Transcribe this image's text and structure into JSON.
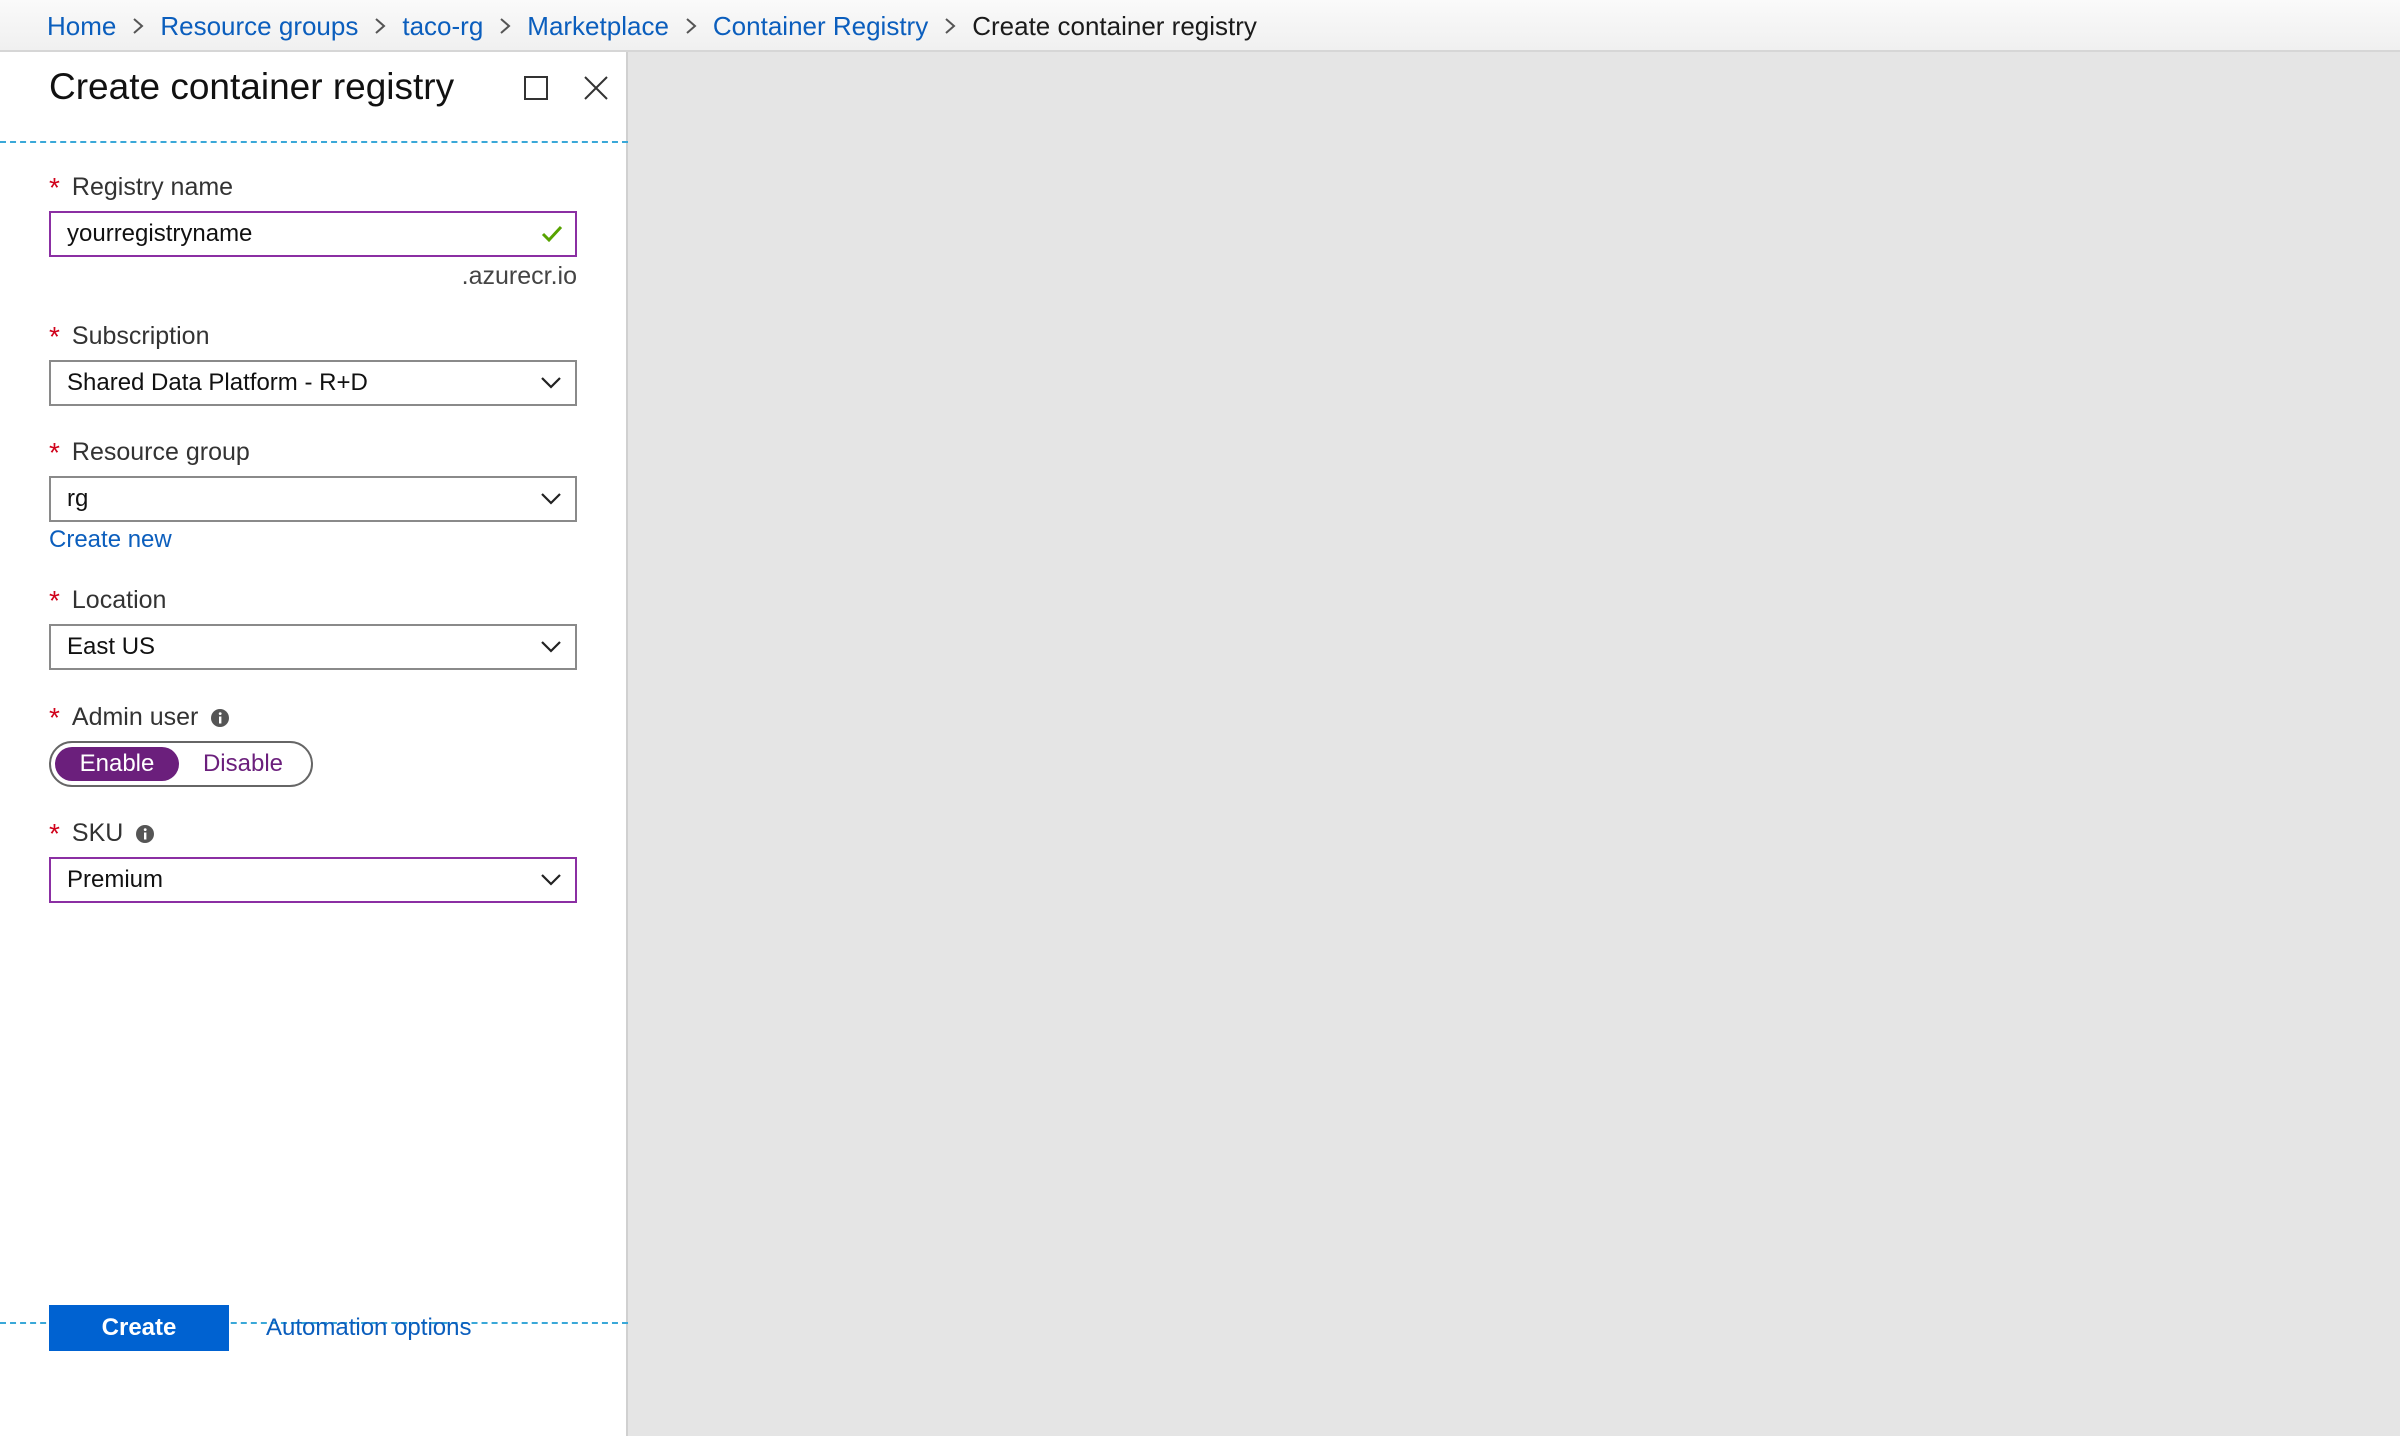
{
  "breadcrumb": {
    "items": [
      "Home",
      "Resource groups",
      "taco-rg",
      "Marketplace",
      "Container Registry"
    ],
    "current": "Create container registry"
  },
  "blade": {
    "title": "Create container registry",
    "maximize_icon": "maximize-icon",
    "close_icon": "close-icon"
  },
  "form": {
    "registry_name": {
      "label": "Registry name",
      "value": "yourregistryname",
      "suffix": ".azurecr.io",
      "valid_icon": "checkmark-icon"
    },
    "subscription": {
      "label": "Subscription",
      "value": "Shared Data Platform - R+D"
    },
    "resource_group": {
      "label": "Resource group",
      "value": "rg",
      "create_new": "Create new"
    },
    "location": {
      "label": "Location",
      "value": "East US"
    },
    "admin_user": {
      "label": "Admin user",
      "options": [
        "Enable",
        "Disable"
      ],
      "selected": "Enable"
    },
    "sku": {
      "label": "SKU",
      "value": "Premium"
    },
    "required_marker": "*"
  },
  "footer": {
    "create_label": "Create",
    "automation_label": "Automation options"
  },
  "colors": {
    "link": "#0b5ebd",
    "required": "#d0021b",
    "accent_purple": "#6b1f7c",
    "primary_button": "#0062d1",
    "valid_check": "#57a300",
    "separator_dashed": "#3aa8d8"
  }
}
